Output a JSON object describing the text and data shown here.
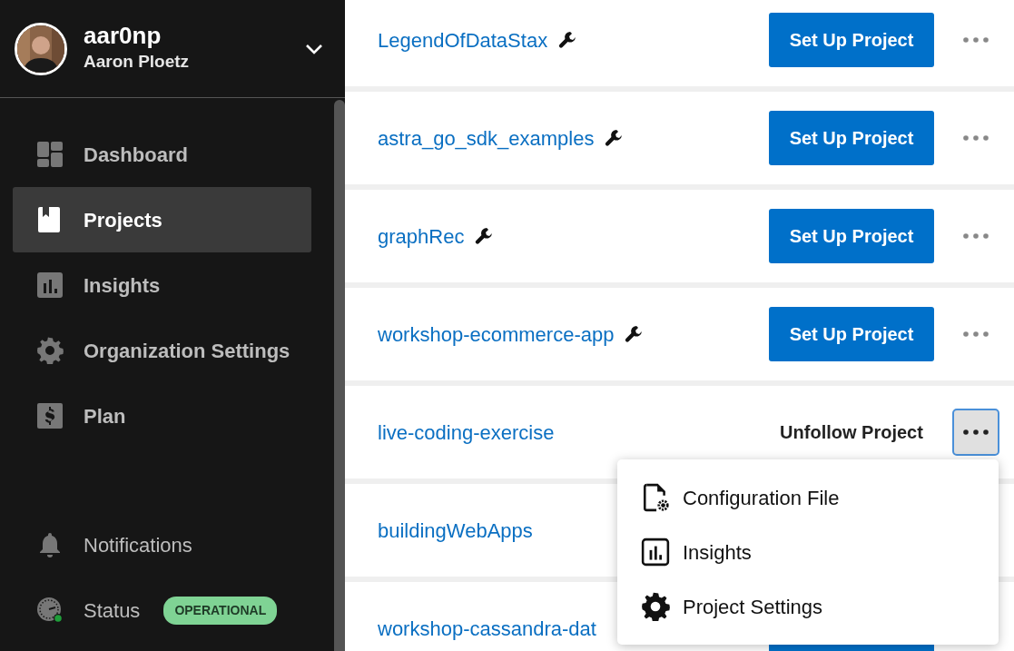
{
  "user": {
    "handle": "aar0np",
    "name": "Aaron Ploetz"
  },
  "nav": [
    {
      "label": "Dashboard",
      "selected": false
    },
    {
      "label": "Projects",
      "selected": true
    },
    {
      "label": "Insights",
      "selected": false
    },
    {
      "label": "Organization Settings",
      "selected": false
    },
    {
      "label": "Plan",
      "selected": false
    }
  ],
  "footer_nav": [
    {
      "label": "Notifications"
    },
    {
      "label": "Status",
      "badge": "OPERATIONAL"
    }
  ],
  "projects": [
    {
      "name": "LegendOfDataStax",
      "wrench": true,
      "action": {
        "kind": "setup",
        "label": "Set Up Project"
      },
      "more": {
        "active": false
      }
    },
    {
      "name": "astra_go_sdk_examples",
      "wrench": true,
      "action": {
        "kind": "setup",
        "label": "Set Up Project"
      },
      "more": {
        "active": false
      }
    },
    {
      "name": "graphRec",
      "wrench": true,
      "action": {
        "kind": "setup",
        "label": "Set Up Project"
      },
      "more": {
        "active": false
      }
    },
    {
      "name": "workshop-ecommerce-app",
      "wrench": true,
      "action": {
        "kind": "setup",
        "label": "Set Up Project"
      },
      "more": {
        "active": false
      }
    },
    {
      "name": "live-coding-exercise",
      "wrench": false,
      "action": {
        "kind": "unfollow",
        "label": "Unfollow Project"
      },
      "more": {
        "active": true
      }
    },
    {
      "name": "buildingWebApps",
      "wrench": false
    },
    {
      "name": "workshop-cassandra-dat",
      "wrench": false,
      "action": {
        "kind": "setup-covered"
      }
    }
  ],
  "menu": [
    {
      "label": "Configuration File"
    },
    {
      "label": "Insights"
    },
    {
      "label": "Project Settings"
    }
  ]
}
